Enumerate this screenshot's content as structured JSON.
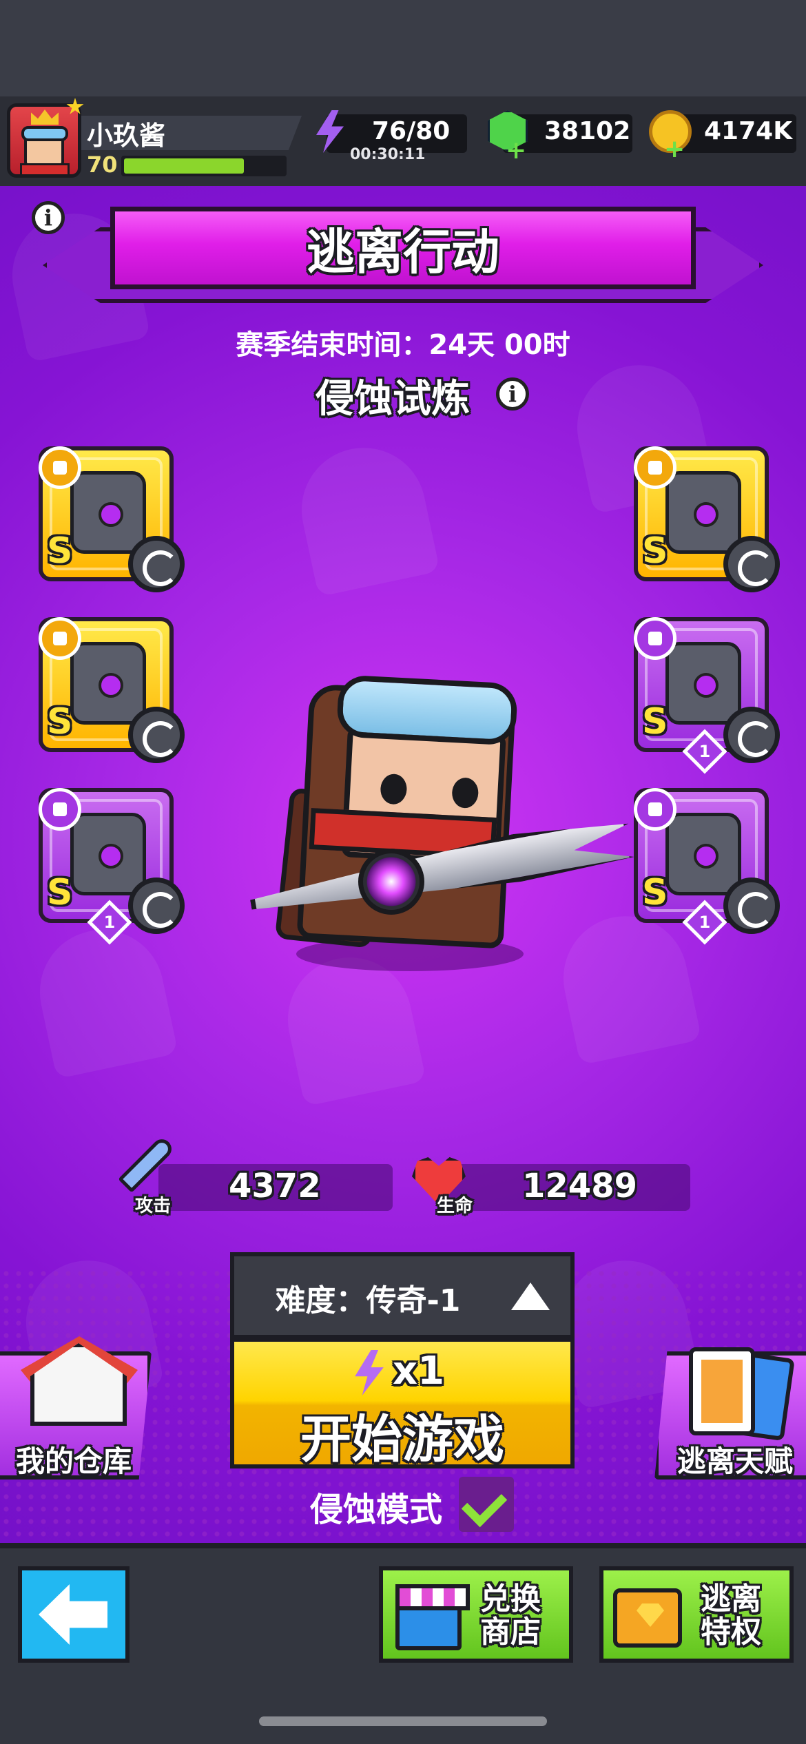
{
  "player": {
    "name": "小玖酱",
    "level": "70",
    "xp_fraction": 0.75
  },
  "resources": {
    "energy": "76/80",
    "energy_timer": "00:30:11",
    "gems": "38102",
    "coins": "4174K"
  },
  "event": {
    "title": "逃离行动",
    "season_text": "赛季结束时间：24天 00时",
    "trial_title": "侵蚀试炼"
  },
  "equipment": {
    "left": [
      {
        "slot": "weapon",
        "grade": "S",
        "rarity": "gold",
        "icon": "sword-slot-icon"
      },
      {
        "slot": "necklace",
        "grade": "S",
        "rarity": "gold",
        "icon": "necklace-slot-icon"
      },
      {
        "slot": "gloves",
        "grade": "S",
        "rarity": "purple",
        "icon": "glove-slot-icon",
        "level": "1"
      }
    ],
    "right": [
      {
        "slot": "armor",
        "grade": "S",
        "rarity": "gold",
        "icon": "armor-slot-icon"
      },
      {
        "slot": "belt",
        "grade": "S",
        "rarity": "purple",
        "icon": "belt-slot-icon",
        "level": "1"
      },
      {
        "slot": "boots",
        "grade": "S",
        "rarity": "purple",
        "icon": "boots-slot-icon",
        "level": "1"
      }
    ]
  },
  "stats": {
    "attack_label": "攻击",
    "attack_value": "4372",
    "hp_label": "生命",
    "hp_value": "12489"
  },
  "play": {
    "difficulty": "难度：传奇-1",
    "energy_cost": "x1",
    "start_label": "开始游戏",
    "mode_label": "侵蚀模式",
    "mode_enabled": true
  },
  "side_buttons": {
    "warehouse": "我的仓库",
    "talent": "逃离天赋"
  },
  "nav": {
    "shop": "兑换商店",
    "privilege": "逃离特权"
  },
  "colors": {
    "accent_purple": "#a728e6",
    "banner_pink": "#e01ee8",
    "start_yellow": "#ffd400",
    "nav_green": "#7ed636",
    "back_blue": "#22b8f2"
  }
}
